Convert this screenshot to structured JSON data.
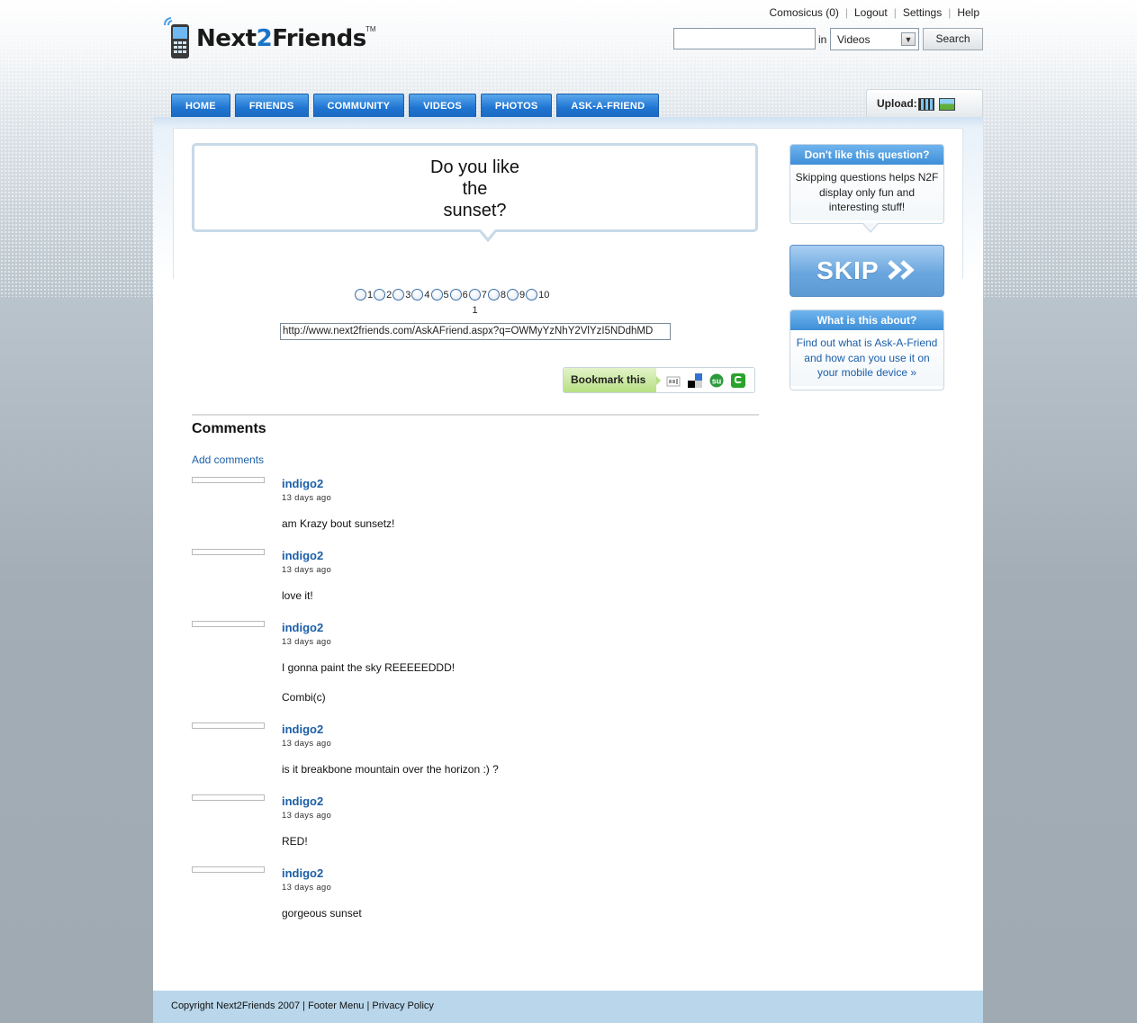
{
  "brand": {
    "name_part1": "Next",
    "name_part2": "2",
    "name_part3": "Friends",
    "tm": "TM"
  },
  "top_links": [
    "Comosicus (0)",
    "Logout",
    "Settings",
    "Help"
  ],
  "search": {
    "value": "",
    "in_label": "in",
    "scope": "Videos",
    "button": "Search"
  },
  "nav": [
    "HOME",
    "FRIENDS",
    "COMMUNITY",
    "VIDEOS",
    "PHOTOS",
    "ASK-A-FRIEND"
  ],
  "upload": {
    "label": "Upload:"
  },
  "question": {
    "text": "Do you like the sunset?"
  },
  "ratings": {
    "options": [
      "1",
      "2",
      "3",
      "4",
      "5",
      "6",
      "7",
      "8",
      "9",
      "10"
    ],
    "selected_display": "1"
  },
  "share_url": "http://www.next2friends.com/AskAFriend.aspx?q=OWMyYzNhY2VlYzI5NDdhMD",
  "bookmark": {
    "label": "Bookmark this",
    "services": [
      "digg-icon",
      "delicious-icon",
      "stumbleupon-icon",
      "technorati-icon"
    ]
  },
  "comments": {
    "title": "Comments",
    "add_label": "Add comments",
    "items": [
      {
        "user": "indigo2",
        "time": "13 days ago",
        "text": "am Krazy bout sunsetz!",
        "text2": ""
      },
      {
        "user": "indigo2",
        "time": "13 days ago",
        "text": "love it!",
        "text2": ""
      },
      {
        "user": "indigo2",
        "time": "13 days ago",
        "text": "I gonna paint the sky REEEEEDDD!",
        "text2": "Combi(c)"
      },
      {
        "user": "indigo2",
        "time": "13 days ago",
        "text": "is it breakbone mountain over the horizon :) ?",
        "text2": ""
      },
      {
        "user": "indigo2",
        "time": "13 days ago",
        "text": "RED!",
        "text2": ""
      },
      {
        "user": "indigo2",
        "time": "13 days ago",
        "text": "gorgeous sunset",
        "text2": ""
      }
    ]
  },
  "sidebar": {
    "dislike": {
      "title": "Don't like this question?",
      "body": "Skipping questions helps N2F display only fun and interesting stuff!"
    },
    "skip_label": "SKIP",
    "about": {
      "title": "What is this about?",
      "body": "Find out what is Ask-A-Friend and how can you use it on your mobile device"
    }
  },
  "footer": {
    "copyright": "Copyright Next2Friends 2007",
    "sep": "|",
    "menu": "Footer Menu",
    "privacy": "Privacy Policy"
  },
  "colors": {
    "nav_blue": "#1f75d2",
    "link_blue": "#1b5fa8",
    "footer_bg": "#b9d6ea",
    "bookmark_green": "#b7e084"
  }
}
